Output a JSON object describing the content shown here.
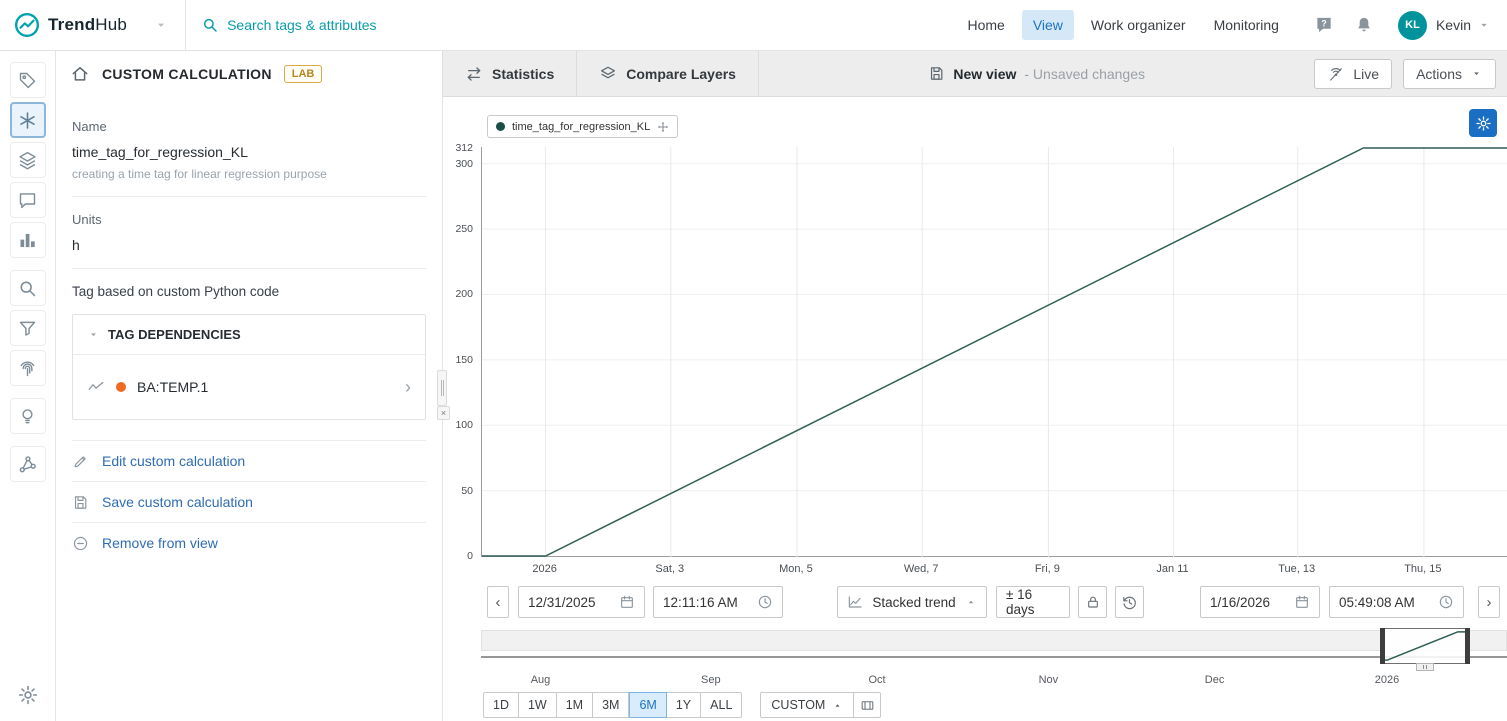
{
  "header": {
    "brand_bold": "Trend",
    "brand_light": "Hub",
    "search": "Search tags & attributes",
    "nav": [
      "Home",
      "View",
      "Work organizer",
      "Monitoring"
    ],
    "active_nav": "View",
    "user_initials": "KL",
    "user_name": "Kevin"
  },
  "toolbar": {
    "title": "CUSTOM CALCULATION",
    "badge": "LAB",
    "tabs": [
      "Statistics",
      "Compare Layers"
    ],
    "view_name": "New view",
    "view_status": "- Unsaved changes",
    "live": "Live",
    "actions": "Actions"
  },
  "sidebar": {
    "items": [
      "tags",
      "custom-calculation",
      "layers",
      "comments",
      "dashboards",
      "search",
      "filter",
      "fingerprint",
      "recommendations",
      "machine-learning",
      "settings"
    ],
    "selected": "custom-calculation"
  },
  "panel": {
    "name_label": "Name",
    "name_value": "time_tag_for_regression_KL",
    "description": "creating a time tag for linear regression purpose",
    "units_label": "Units",
    "units_value": "h",
    "type_text": "Tag based on custom Python code",
    "dependencies_title": "TAG DEPENDENCIES",
    "dependency_tag": "BA:TEMP.1",
    "dependency_color": "#f06a21",
    "links": [
      "Edit custom calculation",
      "Save custom calculation",
      "Remove from view"
    ],
    "collapse_close": "×"
  },
  "chart_data": {
    "type": "line",
    "title": "",
    "xlabel": "",
    "ylabel": "",
    "y_max": 312,
    "y_ticks": [
      0,
      50,
      100,
      150,
      200,
      250,
      300,
      312
    ],
    "x_ticks": [
      {
        "label": "2026",
        "f": 0.062
      },
      {
        "label": "Sat, 3",
        "f": 0.184
      },
      {
        "label": "Mon, 5",
        "f": 0.307
      },
      {
        "label": "Wed, 7",
        "f": 0.429
      },
      {
        "label": "Fri, 9",
        "f": 0.552
      },
      {
        "label": "Jan 11",
        "f": 0.674
      },
      {
        "label": "Tue, 13",
        "f": 0.795
      },
      {
        "label": "Thu, 15",
        "f": 0.918
      }
    ],
    "series": [
      {
        "name": "time_tag_for_regression_KL",
        "color": "#2f5f55",
        "points_f": [
          [
            0,
            0
          ],
          [
            0.062,
            0
          ],
          [
            0.859,
            312
          ],
          [
            1,
            312
          ]
        ]
      }
    ],
    "grid": true,
    "legend_position": "top-left",
    "x_start": "12/31/2025 12:11:16 AM",
    "x_end": "1/16/2026 05:49:08 AM"
  },
  "overview": {
    "type": "line",
    "x_ticks": [
      {
        "label": "Aug",
        "f": 0.058
      },
      {
        "label": "Sep",
        "f": 0.224
      },
      {
        "label": "Oct",
        "f": 0.386
      },
      {
        "label": "Nov",
        "f": 0.553
      },
      {
        "label": "Dec",
        "f": 0.715
      },
      {
        "label": "2026",
        "f": 0.883
      }
    ],
    "selection_f": [
      0.876,
      0.964
    ],
    "preview_points_f": [
      [
        0,
        0
      ],
      [
        0.07,
        0
      ],
      [
        0.87,
        1
      ],
      [
        1,
        1
      ]
    ]
  },
  "controls": {
    "prev": "‹",
    "next": "›",
    "start_date": "12/31/2025",
    "start_time": "12:11:16 AM",
    "mode": "Stacked trend",
    "window": "± 16 days",
    "end_date": "1/16/2026",
    "end_time": "05:49:08 AM",
    "custom": "CUSTOM"
  },
  "ranges": [
    "1D",
    "1W",
    "1M",
    "3M",
    "6M",
    "1Y",
    "ALL"
  ],
  "selected_range": "6M",
  "colors": {
    "brand": "#00a3ad",
    "accent_blue": "#1b74c5",
    "series": "#2f5f55",
    "dependency_orange": "#f06a21"
  }
}
